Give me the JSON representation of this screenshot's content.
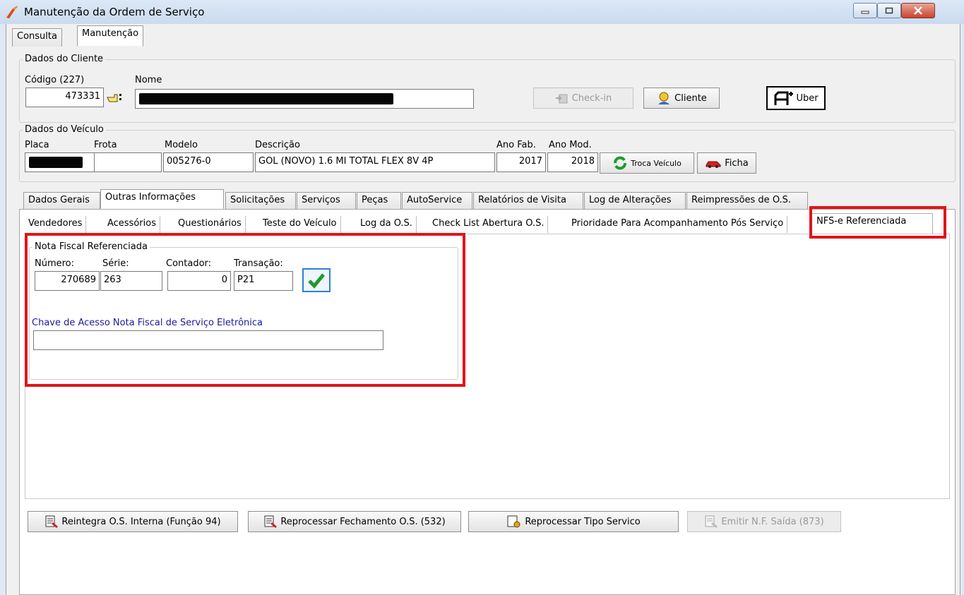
{
  "window": {
    "title": "Manutenção da Ordem de Serviço",
    "icon": "pen-tool-icon",
    "controls": [
      "minimize-icon",
      "maximize-icon",
      "close-icon"
    ]
  },
  "top_tabs": {
    "consulta": "Consulta",
    "manutencao": "Manutenção"
  },
  "cliente": {
    "legend": "Dados do Cliente",
    "codigo_label": "Código (227)",
    "codigo_value": "473331",
    "nome_label": "Nome",
    "nome_value": "",
    "checkin_label": "Check-in",
    "cliente_label": "Cliente",
    "uber_label": "Uber"
  },
  "veiculo": {
    "legend": "Dados do Veículo",
    "placa_label": "Placa",
    "placa_value": "",
    "frota_label": "Frota",
    "frota_value": "",
    "modelo_label": "Modelo",
    "modelo_value": "005276-0",
    "descricao_label": "Descrição",
    "descricao_value": "GOL (NOVO) 1.6 MI TOTAL FLEX 8V 4P",
    "ano_fab_label": "Ano Fab.",
    "ano_fab_value": "2017",
    "ano_mod_label": "Ano Mod.",
    "ano_mod_value": "2018",
    "troca_label": "Troca Veículo",
    "ficha_label": "Ficha"
  },
  "main_tabs": [
    "Dados Gerais",
    "Outras Informações",
    "Solicitações",
    "Serviços",
    "Peças",
    "AutoService",
    "Relatórios de Visita",
    "Log de Alterações",
    "Reimpressões de O.S."
  ],
  "sub_tabs": [
    "Vendedores",
    "Acessórios",
    "Questionários",
    "Teste do Veículo",
    "Log da O.S.",
    "Check List Abertura O.S.",
    "Prioridade Para Acompanhamento Pós Serviço",
    "NFS-e Referenciada"
  ],
  "nota": {
    "legend": "Nota Fiscal Referenciada",
    "numero_label": "Número:",
    "numero_value": "270689",
    "serie_label": "Série:",
    "serie_value": "263",
    "contador_label": "Contador:",
    "contador_value": "0",
    "transacao_label": "Transação:",
    "transacao_value": "P21",
    "chave_label": "Chave de Acesso Nota Fiscal de Serviço Eletrônica",
    "chave_value": ""
  },
  "bottom_buttons": {
    "reintegra": "Reintegra O.S. Interna (Função 94)",
    "reprocessar_fechamento": "Reprocessar Fechamento O.S. (532)",
    "reprocessar_tipo": "Reprocessar Tipo Servico",
    "emitir_nf": "Emitir N.F. Saída (873)"
  },
  "colors": {
    "highlight": "#e1141b",
    "chave_label": "#1a1aa6",
    "confirm_green": "#1f9b2b"
  }
}
